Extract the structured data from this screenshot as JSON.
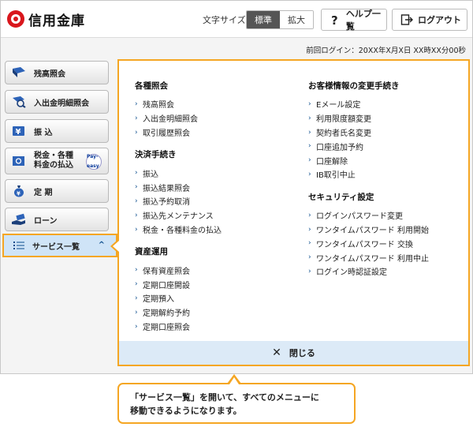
{
  "header": {
    "logo_text": "信用金庫",
    "fontsize_label": "文字サイズ",
    "fontsize_standard": "標準",
    "fontsize_large": "拡大",
    "help_label": "ヘルプ一覧",
    "logout_label": "ログアウト"
  },
  "last_login": "前回ログイン：20XX年X月X日 XX時XX分00秒",
  "sidebar": {
    "items": [
      {
        "label": "残高照会"
      },
      {
        "label": "入出金明細照会"
      },
      {
        "label": "振 込"
      },
      {
        "label_line1": "税金・各種",
        "label_line2": "料金の払込",
        "badge": "Pay-easy"
      },
      {
        "label": "定 期"
      },
      {
        "label": "ローン"
      }
    ],
    "service": {
      "label": "サービス一覧",
      "chevron": "^"
    }
  },
  "menu": {
    "left": [
      {
        "title": "各種照会",
        "items": [
          "残高照会",
          "入出金明細照会",
          "取引履歴照会"
        ]
      },
      {
        "title": "決済手続き",
        "items": [
          "振込",
          "振込結果照会",
          "振込予約取消",
          "振込先メンテナンス",
          "税金・各種料金の払込"
        ]
      },
      {
        "title": "資産運用",
        "items": [
          "保有資産照会",
          "定期口座開設",
          "定期預入",
          "定期解約予約",
          "定期口座照会"
        ]
      }
    ],
    "right": [
      {
        "title": "お客様情報の変更手続き",
        "items": [
          "Eメール設定",
          "利用限度額変更",
          "契約者氏名変更",
          "口座追加予約",
          "口座解除",
          "IB取引中止"
        ]
      },
      {
        "title": "セキュリティ設定",
        "items": [
          "ログインパスワード変更",
          "ワンタイムパスワード 利用開始",
          "ワンタイムパスワード 交換",
          "ワンタイムパスワード 利用中止",
          "ログイン時認証設定"
        ]
      }
    ],
    "close_label": "閉じる",
    "arrow": "›"
  },
  "callout": {
    "line1": "「サービス一覧」を開いて、すべてのメニューに",
    "line2": "移動できるようになります。"
  },
  "colors": {
    "accent": "#f5a623",
    "nav_blue": "#0a4c8c",
    "active_bg": "#cfe4f7"
  }
}
